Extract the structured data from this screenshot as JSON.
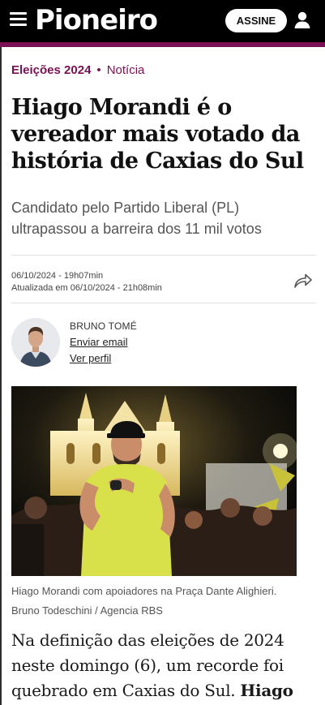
{
  "header": {
    "brand": "Pioneiro",
    "subscribe_label": "ASSINE",
    "menu_icon": "menu-icon",
    "user_icon": "user-icon",
    "accent_color": "#7b1154"
  },
  "article": {
    "section": "Eleições 2024",
    "separator": "•",
    "type": "Notícia",
    "headline": "Hiago Morandi é o vereador mais votado da história de Caxias do Sul",
    "dek": "Candidato pelo Partido Liberal (PL) ultrapassou a barreira dos 11 mil votos",
    "published": "06/10/2024 - 19h07min",
    "updated": "Atualizada em 06/10/2024 - 21h08min",
    "share_icon": "share-icon"
  },
  "author": {
    "name": "BRUNO TOMÉ",
    "email_label": "Enviar email",
    "profile_label": "Ver perfil"
  },
  "photo": {
    "caption": "Hiago Morandi com apoiadores na Praça Dante Alighieri.",
    "credit": "Bruno Todeschini / Agencia RBS"
  },
  "body": {
    "lead": "Na definição das eleições de 2024 neste domingo (6), um recorde foi quebrado em Caxias do Sul.",
    "lead_bold": "Hiago"
  }
}
